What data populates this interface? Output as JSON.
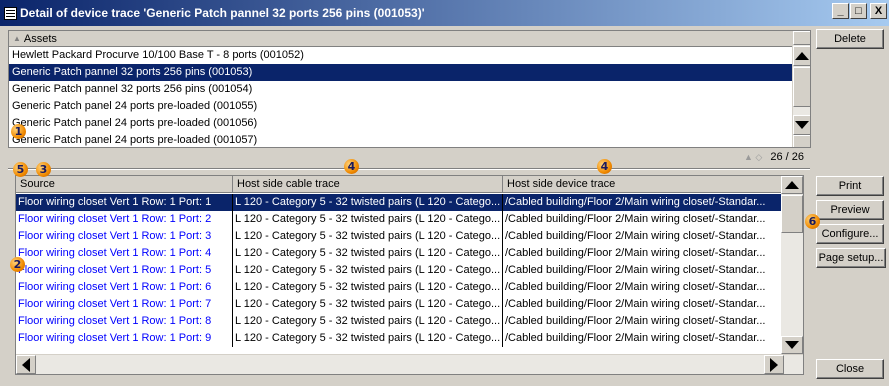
{
  "window": {
    "title": "Detail of device trace 'Generic Patch pannel 32 ports 256 pins (001053)'",
    "minimize": "_",
    "maximize": "□",
    "close": "X"
  },
  "assets": {
    "column_header": "Assets",
    "rows": [
      "Hewlett Packard Procurve 10/100 Base T - 8 ports (001052)",
      "Generic Patch pannel 32 ports 256 pins (001053)",
      "Generic Patch pannel 32 ports 256 pins (001054)",
      "Generic Patch panel 24 ports pre-loaded (001055)",
      "Generic Patch panel 24 ports pre-loaded (001056)",
      "Generic Patch panel 24 ports pre-loaded (001057)"
    ],
    "selected_index": 1,
    "counter": "26 / 26"
  },
  "trace": {
    "columns": [
      "Source",
      "Host side cable trace",
      "Host side device trace"
    ],
    "rows": [
      [
        "Floor wiring closet Vert 1 Row: 1 Port: 1",
        "L 120 - Category 5 - 32 twisted pairs (L 120 - Catego...",
        "/Cabled building/Floor 2/Main wiring closet/-Standar..."
      ],
      [
        "Floor wiring closet Vert 1 Row: 1 Port: 2",
        "L 120 - Category 5 - 32 twisted pairs (L 120 - Catego...",
        "/Cabled building/Floor 2/Main wiring closet/-Standar..."
      ],
      [
        "Floor wiring closet Vert 1 Row: 1 Port: 3",
        "L 120 - Category 5 - 32 twisted pairs (L 120 - Catego...",
        "/Cabled building/Floor 2/Main wiring closet/-Standar..."
      ],
      [
        "Floor wiring closet Vert 1 Row: 1 Port: 4",
        "L 120 - Category 5 - 32 twisted pairs (L 120 - Catego...",
        "/Cabled building/Floor 2/Main wiring closet/-Standar..."
      ],
      [
        "Floor wiring closet Vert 1 Row: 1 Port: 5",
        "L 120 - Category 5 - 32 twisted pairs (L 120 - Catego...",
        "/Cabled building/Floor 2/Main wiring closet/-Standar..."
      ],
      [
        "Floor wiring closet Vert 1 Row: 1 Port: 6",
        "L 120 - Category 5 - 32 twisted pairs (L 120 - Catego...",
        "/Cabled building/Floor 2/Main wiring closet/-Standar..."
      ],
      [
        "Floor wiring closet Vert 1 Row: 1 Port: 7",
        "L 120 - Category 5 - 32 twisted pairs (L 120 - Catego...",
        "/Cabled building/Floor 2/Main wiring closet/-Standar..."
      ],
      [
        "Floor wiring closet Vert 1 Row: 1 Port: 8",
        "L 120 - Category 5 - 32 twisted pairs (L 120 - Catego...",
        "/Cabled building/Floor 2/Main wiring closet/-Standar..."
      ],
      [
        "Floor wiring closet Vert 1 Row: 1 Port: 9",
        "L 120 - Category 5 - 32 twisted pairs (L 120 - Catego...",
        "/Cabled building/Floor 2/Main wiring closet/-Standar..."
      ]
    ],
    "selected_index": 0
  },
  "buttons": {
    "delete": "Delete",
    "print": "Print",
    "preview": "Preview",
    "configure": "Configure...",
    "page_setup": "Page setup...",
    "close": "Close"
  },
  "callouts": [
    "1",
    "2",
    "3",
    "4",
    "4",
    "5",
    "6"
  ],
  "colors": {
    "selection": "#0a246a",
    "link_text": "#0000ff",
    "callout": "#f08a00",
    "face": "#d4d0c8"
  }
}
